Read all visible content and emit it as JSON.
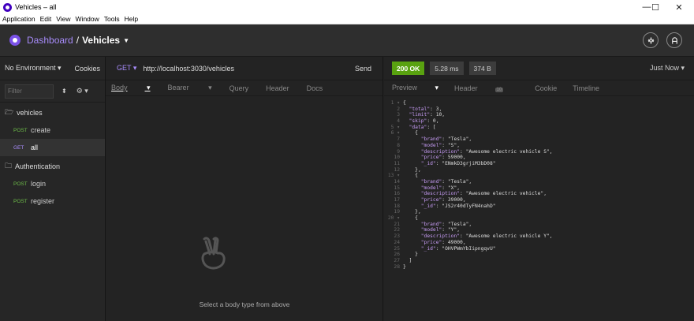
{
  "window": {
    "title": "Vehicles – all",
    "min": "—",
    "max": "☐",
    "close": "✕"
  },
  "menu": [
    "Application",
    "Edit",
    "View",
    "Window",
    "Tools",
    "Help"
  ],
  "header": {
    "dashboard": "Dashboard",
    "separator": "/",
    "current": "Vehicles"
  },
  "sidebar": {
    "environment": "No Environment",
    "cookies": "Cookies",
    "filter_placeholder": "Filter",
    "folder1": "vehicles",
    "folder1_items": [
      {
        "method": "POST",
        "label": "create"
      },
      {
        "method": "GET",
        "label": "all"
      }
    ],
    "folder2": "Authentication",
    "folder2_items": [
      {
        "method": "POST",
        "label": "login"
      },
      {
        "method": "POST",
        "label": "register"
      }
    ]
  },
  "request": {
    "method": "GET",
    "url": "http://localhost:3030/vehicles",
    "send": "Send",
    "tabs": [
      "Body",
      "Bearer",
      "Query",
      "Header",
      "Docs"
    ],
    "empty_message": "Select a body type from above"
  },
  "response": {
    "status": "200 OK",
    "time": "5.28 ms",
    "size": "374 B",
    "when": "Just Now",
    "tabs": {
      "preview": "Preview",
      "header": "Header",
      "header_count": "10",
      "cookie": "Cookie",
      "timeline": "Timeline"
    },
    "lines": [
      "{",
      "  \"total\": 3,",
      "  \"limit\": 10,",
      "  \"skip\": 0,",
      "  \"data\": [",
      "    {",
      "      \"brand\": \"Tesla\",",
      "      \"model\": \"S\",",
      "      \"description\": \"Awesome electric vehicle S\",",
      "      \"price\": 59000,",
      "      \"_id\": \"ENmkD3grjiM3bD08\"",
      "    },",
      "    {",
      "      \"brand\": \"Tesla\",",
      "      \"model\": \"X\",",
      "      \"description\": \"Awesome electric vehicle\",",
      "      \"price\": 39000,",
      "      \"_id\": \"JS2r40dTyFN4nahD\"",
      "    },",
      "    {",
      "      \"brand\": \"Tesla\",",
      "      \"model\": \"Y\",",
      "      \"description\": \"Awesome electric vehicle Y\",",
      "      \"price\": 49000,",
      "      \"_id\": \"OHVPWmYbIipngqvU\"",
      "    }",
      "  ]",
      "}"
    ],
    "foldable_lines": [
      1,
      5,
      6,
      13,
      20
    ]
  },
  "colors": {
    "accent": "#7b52e8",
    "ok": "#59a210",
    "post": "#6fbf4a",
    "get": "#a78bfa"
  },
  "icons": [
    "settings-icon",
    "account-icon",
    "folder-icon",
    "peace-hand-icon"
  ]
}
